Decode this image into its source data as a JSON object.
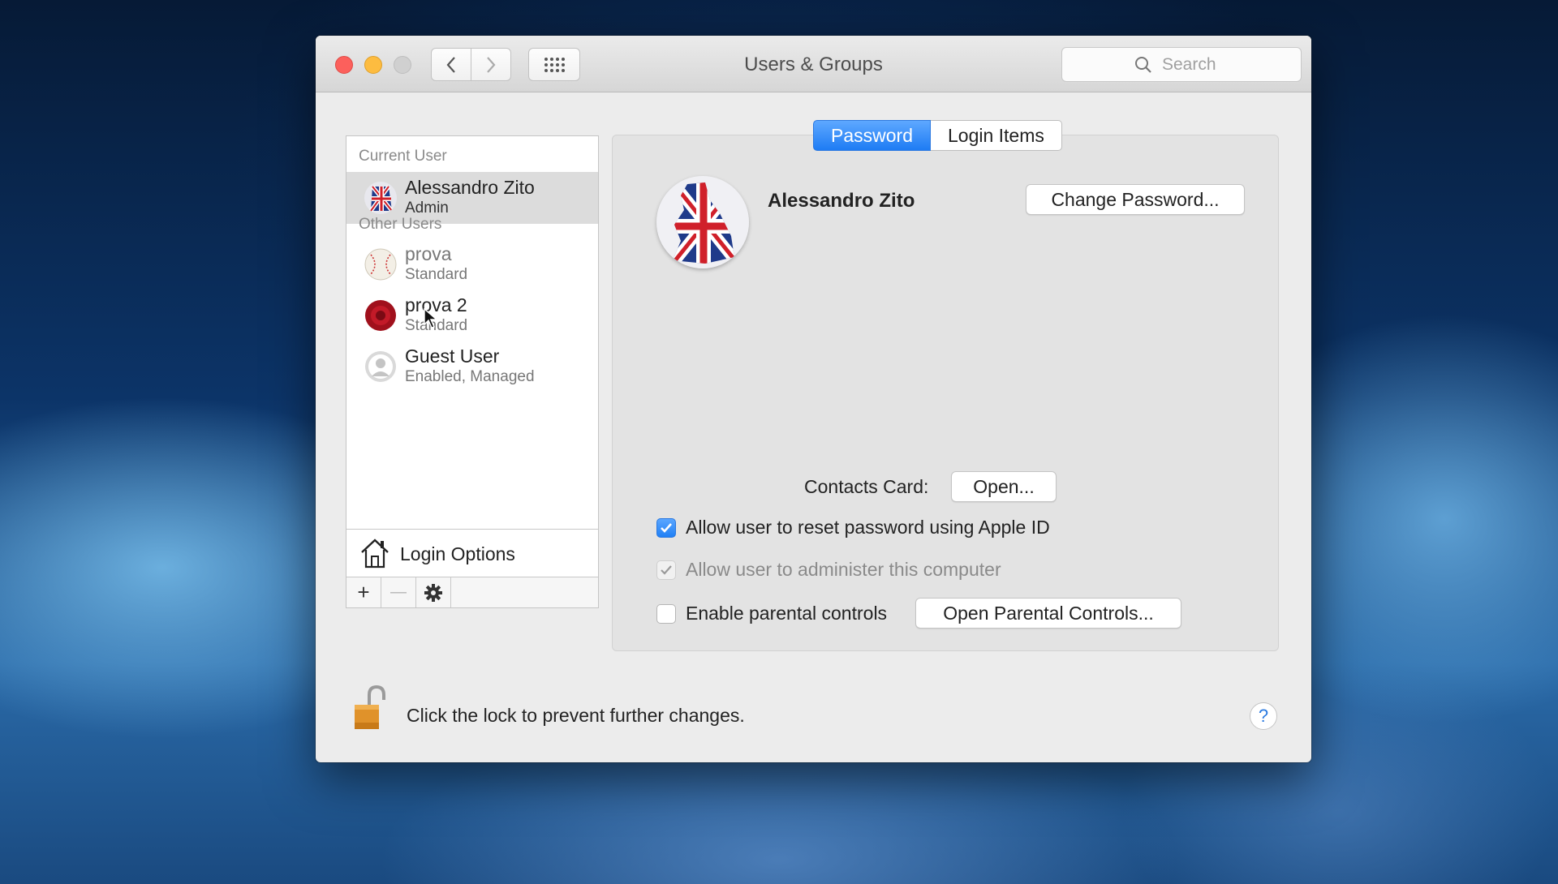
{
  "window": {
    "title": "Users & Groups"
  },
  "search": {
    "placeholder": "Search"
  },
  "sidebar": {
    "current_label": "Current User",
    "current_user": {
      "name": "Alessandro Zito",
      "role": "Admin",
      "icon": "union-jack-avatar"
    },
    "other_label": "Other Users",
    "other_users": [
      {
        "name": "prova",
        "role": "Standard",
        "icon": "baseball-avatar"
      },
      {
        "name": "prova 2",
        "role": "Standard",
        "icon": "red-flower-avatar"
      },
      {
        "name": "Guest User",
        "role": "Enabled, Managed",
        "icon": "generic-user-avatar"
      }
    ],
    "login_options": "Login Options",
    "add_symbol": "+",
    "remove_symbol": "—"
  },
  "tabs": [
    {
      "label": "Password",
      "active": true
    },
    {
      "label": "Login Items",
      "active": false
    }
  ],
  "detail": {
    "full_name": "Alessandro Zito",
    "change_password": "Change Password...",
    "contacts_label": "Contacts Card:",
    "open_button": "Open...",
    "checks": [
      {
        "label": "Allow user to reset password using Apple ID",
        "checked": true,
        "enabled": true
      },
      {
        "label": "Allow user to administer this computer",
        "checked": true,
        "enabled": false
      },
      {
        "label": "Enable parental controls",
        "checked": false,
        "enabled": true
      }
    ],
    "parental_button": "Open Parental Controls..."
  },
  "footer": {
    "lock_text": "Click the lock to prevent further changes.",
    "help_symbol": "?"
  },
  "colors": {
    "accent": "#1e7cf4",
    "close": "#fc605c",
    "minimize": "#fdbc40"
  }
}
